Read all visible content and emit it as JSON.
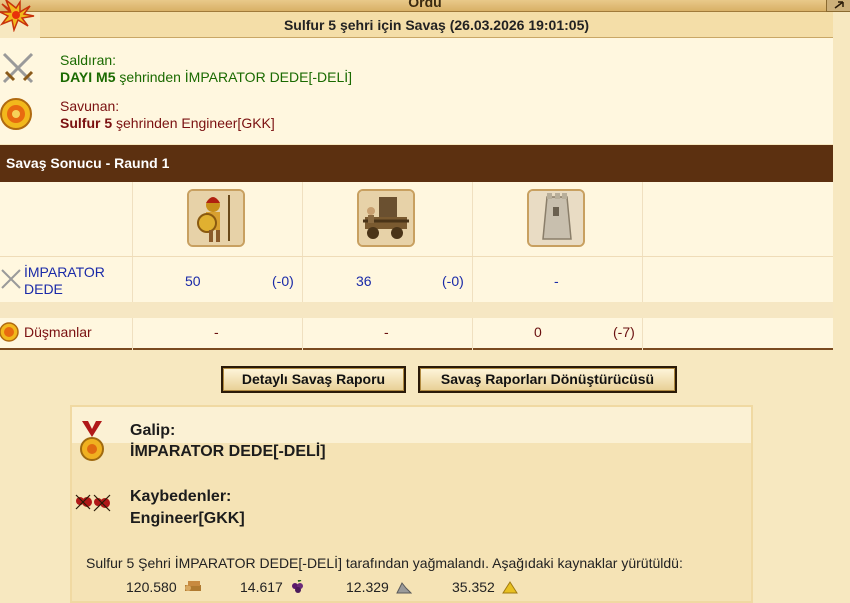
{
  "topbar": {
    "title": "Ordu"
  },
  "header": {
    "title": "Sulfur 5 şehri için Savaş (26.03.2026 19:01:05)"
  },
  "attacker": {
    "label": "Saldıran:",
    "city": "DAYI M5",
    "suffix": " şehrinden İMPARATOR DEDE[-DELİ]"
  },
  "defender": {
    "label": "Savunan:",
    "city": "Sulfur 5",
    "suffix": " şehrinden Engineer[GKK]"
  },
  "result_bar": {
    "title": "Savaş Sonucu - Raund 1"
  },
  "units": [
    {
      "icon": "hoplite-icon"
    },
    {
      "icon": "battering-ram-icon"
    },
    {
      "icon": "wall-icon"
    }
  ],
  "rows": {
    "imparator": {
      "name_line1": "İMPARATOR",
      "name_line2": "DEDE",
      "values": [
        {
          "count": "50",
          "loss": "(-0)"
        },
        {
          "count": "36",
          "loss": "(-0)"
        },
        {
          "count": "-",
          "loss": ""
        }
      ]
    },
    "enemies": {
      "name": "Düşmanlar",
      "values": [
        {
          "count": "-",
          "loss": ""
        },
        {
          "count": "-",
          "loss": ""
        },
        {
          "count": "0",
          "loss": "(-7)"
        }
      ]
    }
  },
  "buttons": {
    "detailed_report": "Detaylı Savaş Raporu",
    "converter": "Savaş Raporları Dönüştürücüsü"
  },
  "summary": {
    "winner_label": "Galip:",
    "winner_name": "İMPARATOR DEDE[-DELİ]",
    "losers_label": "Kaybedenler:",
    "losers_name": "Engineer[GKK]",
    "plunder_text": "Sulfur 5 Şehri İMPARATOR DEDE[-DELİ] tarafından yağmalandı. Aşağıdaki kaynaklar yürütüldü:",
    "resources": [
      {
        "amount": "120.580",
        "icon": "wood-icon"
      },
      {
        "amount": "14.617",
        "icon": "wine-icon"
      },
      {
        "amount": "12.329",
        "icon": "marble-icon"
      },
      {
        "amount": "35.352",
        "icon": "sulfur-icon"
      }
    ]
  },
  "colors": {
    "result_bar": "#5c3010",
    "attacker_text": "#1a6a00",
    "defender_text": "#7a1010",
    "unit_count": "#1a2aa8"
  }
}
